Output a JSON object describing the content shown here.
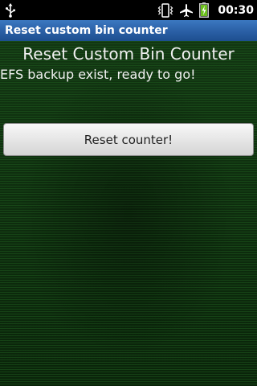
{
  "status_bar": {
    "time": "00:30",
    "icons": [
      "usb-icon",
      "vibrate-icon",
      "airplane-icon",
      "battery-charging-icon"
    ]
  },
  "title_bar": {
    "title": "Reset custom bin counter"
  },
  "main": {
    "heading": "Reset Custom Bin Counter",
    "status_message": "EFS backup exist, ready to go!",
    "reset_button_label": "Reset counter!"
  },
  "colors": {
    "title_bar": "#2a5fa5",
    "background": "#0c2a0c",
    "battery": "#6cbf1e"
  }
}
